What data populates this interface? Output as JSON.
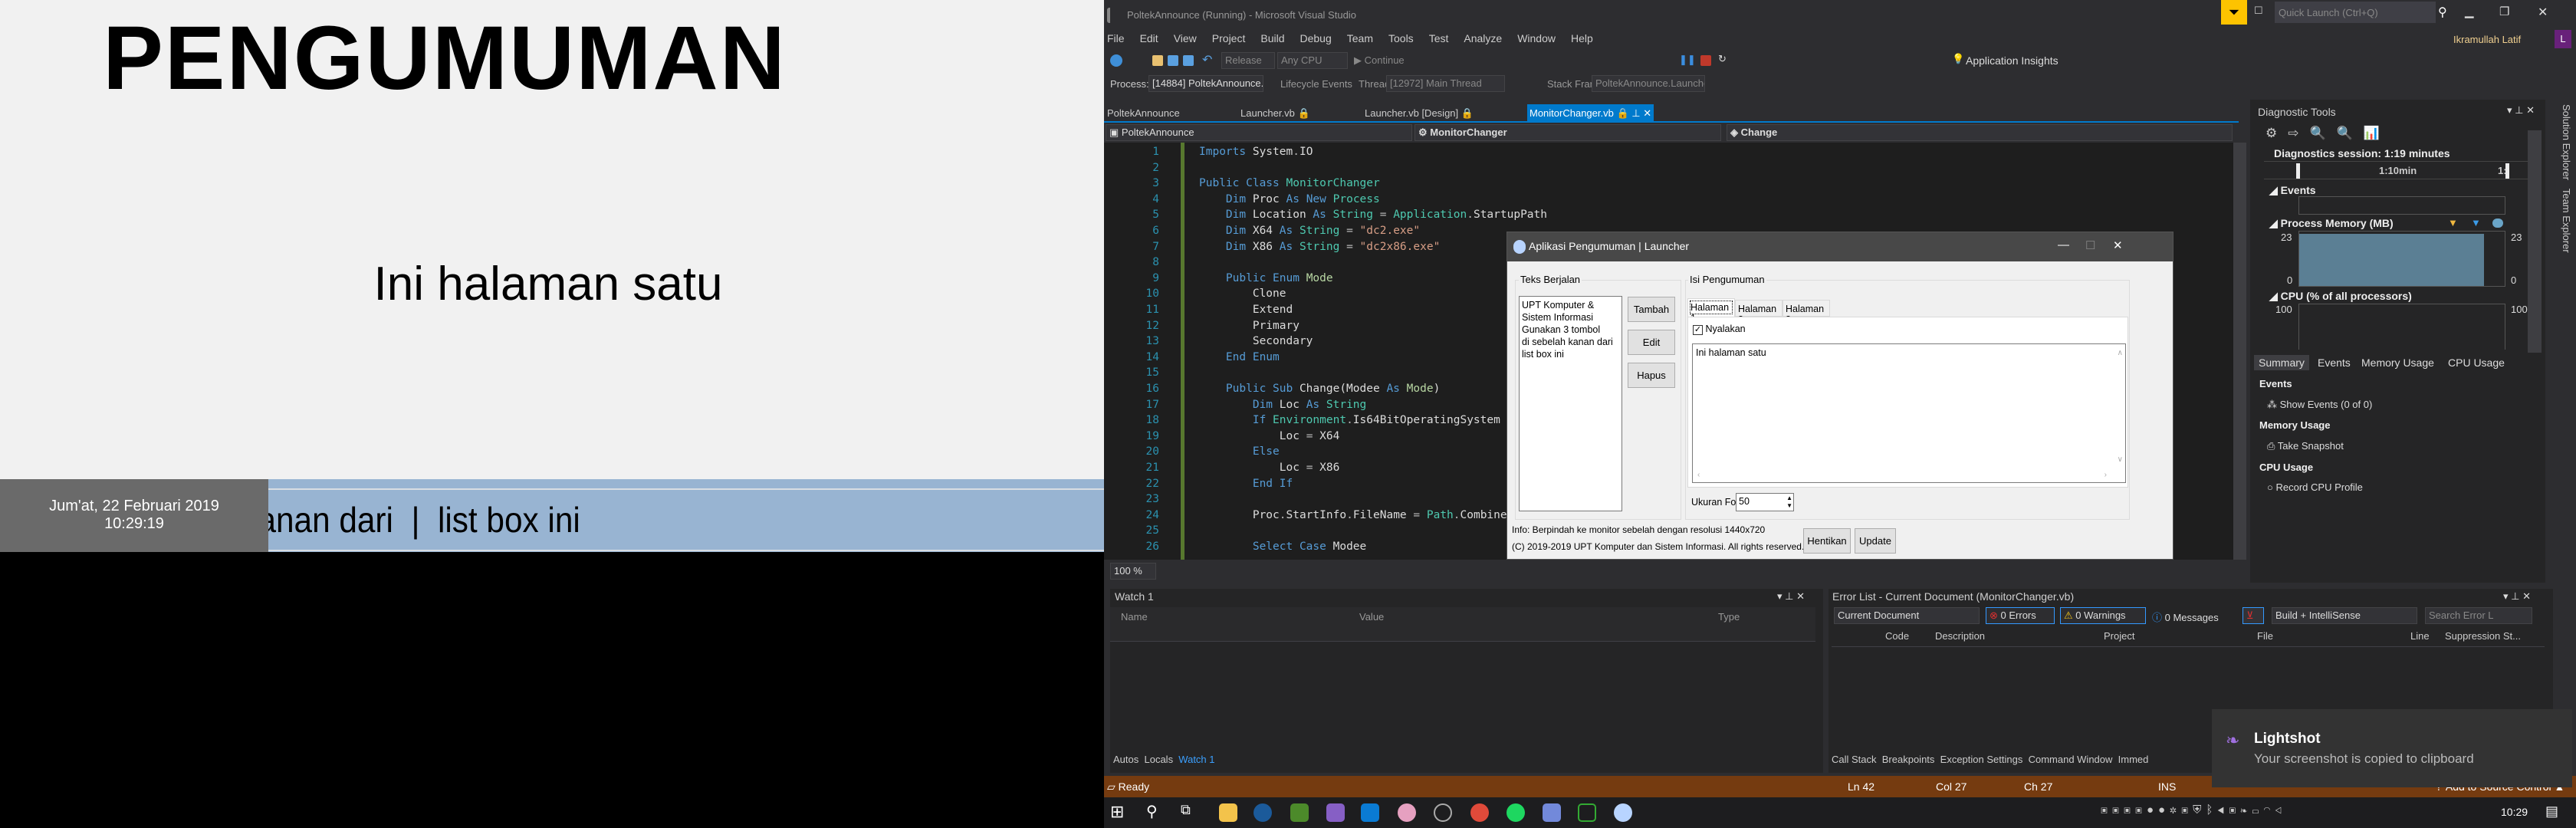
{
  "announcement": {
    "title": "PENGUMUMAN",
    "body": "Ini halaman satu",
    "ticker": "n kanan dari  |  list box ini",
    "date": "Jum'at, 22 Februari 2019",
    "time": "10:29:19"
  },
  "vs": {
    "title": "PoltekAnnounce (Running) - Microsoft Visual Studio",
    "quick_launch": "Quick Launch (Ctrl+Q)",
    "user": "Ikramullah Latif",
    "user_initial": "L",
    "menu": [
      "File",
      "Edit",
      "View",
      "Project",
      "Build",
      "Debug",
      "Team",
      "Tools",
      "Test",
      "Analyze",
      "Window",
      "Help"
    ],
    "toolbar": {
      "config": "Release",
      "platform": "Any CPU",
      "continue": "Continue",
      "app_insights": "Application Insights"
    },
    "process_bar": {
      "process_label": "Process:",
      "process": "[14884] PoltekAnnounce.exe",
      "lifecycle": "Lifecycle Events",
      "thread_label": "Thread:",
      "thread": "[12972] Main Thread",
      "stack_label": "Stack Frame:",
      "stack": "PoltekAnnounce.Launcher.Launcher_Load"
    },
    "tabs": [
      {
        "label": "PoltekAnnounce"
      },
      {
        "label": "Launcher.vb"
      },
      {
        "label": "Launcher.vb [Design]"
      },
      {
        "label": "MonitorChanger.vb"
      }
    ],
    "nav": {
      "project": "PoltekAnnounce",
      "class": "MonitorChanger",
      "member": "Change"
    },
    "zoom": "100 %",
    "code": [
      [
        [
          "Imports ",
          "kw"
        ],
        [
          "System",
          "pl"
        ],
        [
          ".",
          "op"
        ],
        [
          "IO",
          "pl"
        ]
      ],
      [],
      [
        [
          "Public ",
          "kw"
        ],
        [
          "Class ",
          "kw"
        ],
        [
          "MonitorChanger",
          "ty"
        ]
      ],
      [
        [
          "    Dim ",
          "kw"
        ],
        [
          "Proc ",
          "pl"
        ],
        [
          "As ",
          "kw"
        ],
        [
          "New ",
          "kw"
        ],
        [
          "Process",
          "ty"
        ]
      ],
      [
        [
          "    Dim ",
          "kw"
        ],
        [
          "Location ",
          "pl"
        ],
        [
          "As ",
          "kw"
        ],
        [
          "String ",
          "ty"
        ],
        [
          "= ",
          "op"
        ],
        [
          "Application",
          "ty"
        ],
        [
          ".",
          "op"
        ],
        [
          "StartupPath",
          "pl"
        ]
      ],
      [
        [
          "    Dim ",
          "kw"
        ],
        [
          "X64 ",
          "pl"
        ],
        [
          "As ",
          "kw"
        ],
        [
          "String ",
          "ty"
        ],
        [
          "= ",
          "op"
        ],
        [
          "\"dc2.exe\"",
          "st"
        ]
      ],
      [
        [
          "    Dim ",
          "kw"
        ],
        [
          "X86 ",
          "pl"
        ],
        [
          "As ",
          "kw"
        ],
        [
          "String ",
          "ty"
        ],
        [
          "= ",
          "op"
        ],
        [
          "\"dc2x86.exe\"",
          "st"
        ]
      ],
      [],
      [
        [
          "    Public ",
          "kw"
        ],
        [
          "Enum ",
          "kw"
        ],
        [
          "Mode",
          "en"
        ]
      ],
      [
        [
          "        Clone",
          "pl"
        ]
      ],
      [
        [
          "        Extend",
          "pl"
        ]
      ],
      [
        [
          "        Primary",
          "pl"
        ]
      ],
      [
        [
          "        Secondary",
          "pl"
        ]
      ],
      [
        [
          "    End ",
          "kw"
        ],
        [
          "Enum",
          "kw"
        ]
      ],
      [],
      [
        [
          "    Public ",
          "kw"
        ],
        [
          "Sub ",
          "kw"
        ],
        [
          "Change(Modee ",
          "pl"
        ],
        [
          "As ",
          "kw"
        ],
        [
          "Mode",
          "en"
        ],
        [
          ")",
          "pl"
        ]
      ],
      [
        [
          "        Dim ",
          "kw"
        ],
        [
          "Loc ",
          "pl"
        ],
        [
          "As ",
          "kw"
        ],
        [
          "String",
          "ty"
        ]
      ],
      [
        [
          "        If ",
          "kw"
        ],
        [
          "Environment",
          "ty"
        ],
        [
          ".",
          "op"
        ],
        [
          "Is64BitOperatingSystem",
          "pl"
        ]
      ],
      [
        [
          "            Loc ",
          "pl"
        ],
        [
          "= ",
          "op"
        ],
        [
          "X64",
          "pl"
        ]
      ],
      [
        [
          "        Else",
          "kw"
        ]
      ],
      [
        [
          "            Loc ",
          "pl"
        ],
        [
          "= ",
          "op"
        ],
        [
          "X86",
          "pl"
        ]
      ],
      [
        [
          "        End ",
          "kw"
        ],
        [
          "If",
          "kw"
        ]
      ],
      [],
      [
        [
          "        Proc",
          "pl"
        ],
        [
          ".",
          "op"
        ],
        [
          "StartInfo",
          "pl"
        ],
        [
          ".",
          "op"
        ],
        [
          "FileName ",
          "pl"
        ],
        [
          "= ",
          "op"
        ],
        [
          "Path",
          "ty"
        ],
        [
          ".",
          "op"
        ],
        [
          "Combine",
          "pl"
        ]
      ],
      [],
      [
        [
          "        Select ",
          "kw"
        ],
        [
          "Case ",
          "kw"
        ],
        [
          "Modee",
          "pl"
        ]
      ]
    ],
    "diagnostics": {
      "title": "Diagnostic Tools",
      "session": "Diagnostics session: 1:19 minutes",
      "timeline_label": "1:10min",
      "timeline_label2": "1:",
      "events": "Events",
      "memory": "Process Memory (MB)",
      "mem_max": "23",
      "mem_min": "0",
      "mem_value_mb": 22,
      "cpu": "CPU (% of all processors)",
      "cpu_max": "100",
      "tabs": [
        "Summary",
        "Events",
        "Memory Usage",
        "CPU Usage"
      ],
      "sections": [
        {
          "title": "Events",
          "action": "Show Events (0 of 0)"
        },
        {
          "title": "Memory Usage",
          "action": "Take Snapshot"
        },
        {
          "title": "CPU Usage",
          "action": "Record CPU Profile"
        }
      ]
    },
    "side_tabs": [
      "Solution Explorer",
      "Team Explorer"
    ],
    "watch": {
      "title": "Watch 1",
      "columns": [
        "Name",
        "Value",
        "Type"
      ],
      "tabs": [
        "Autos",
        "Locals",
        "Watch 1"
      ]
    },
    "errors": {
      "title": "Error List - Current Document (MonitorChanger.vb)",
      "scope": "Current Document",
      "errors": "0 Errors",
      "warnings": "0 Warnings",
      "messages": "0 Messages",
      "build": "Build + IntelliSense",
      "search": "Search Error L",
      "columns": [
        "Code",
        "Description",
        "Project",
        "File",
        "Line",
        "Suppression St..."
      ],
      "tabs": [
        "Call Stack",
        "Breakpoints",
        "Exception Settings",
        "Command Window",
        "Immed"
      ]
    },
    "status": {
      "ready": "Ready",
      "ln": "Ln 42",
      "col": "Col 27",
      "ch": "Ch 27",
      "ins": "INS",
      "source": "Add to Source Control"
    }
  },
  "dialog": {
    "title": "Aplikasi Pengumuman | Launcher",
    "left_group": "Teks Berjalan",
    "list": [
      "UPT Komputer & Sistem Informasi",
      "Gunakan 3 tombol",
      "di sebelah kanan dari",
      "list box ini"
    ],
    "buttons": [
      "Tambah",
      "Edit",
      "Hapus"
    ],
    "right_group": "Isi Pengumuman",
    "tabs": [
      "Halaman 1",
      "Halaman 2",
      "Halaman 3"
    ],
    "checkbox": "Nyalakan",
    "checked": true,
    "text": "Ini halaman satu",
    "font_label": "Ukuran Font",
    "font_value": "50",
    "info": "Info: Berpindah ke monitor sebelah dengan resolusi 1440x720",
    "copyright": "(C) 2019-2019 UPT Komputer dan Sistem Informasi. All rights reserved.",
    "stop": "Hentikan",
    "update": "Update"
  },
  "toast": {
    "title": "Lightshot",
    "message": "Your screenshot is copied to clipboard"
  },
  "taskbar": {
    "time": "10:29"
  },
  "colors": {
    "status_bar": "#753b10",
    "accent": "#007acc",
    "ticker": "#98b4d2",
    "memory_fill": "#5b7f94"
  }
}
